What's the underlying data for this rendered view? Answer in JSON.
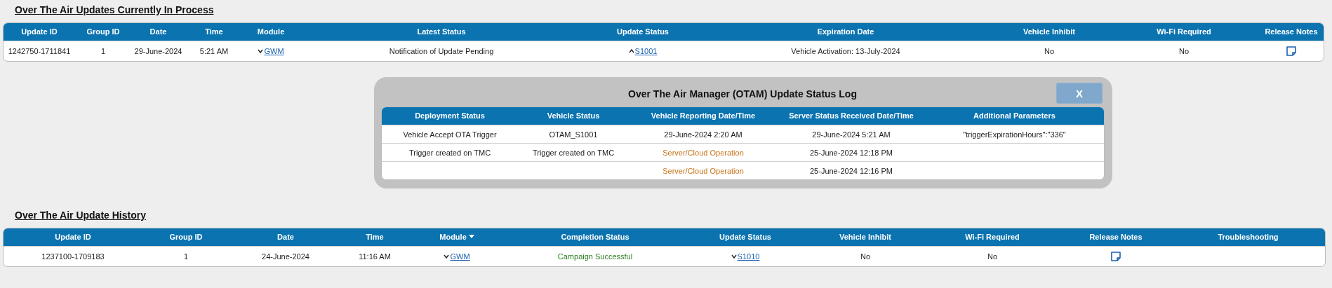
{
  "current": {
    "title": "Over The Air Updates Currently In Process",
    "columns": [
      {
        "label": "Update ID",
        "sorted": false
      },
      {
        "label": "Group ID",
        "sorted": false
      },
      {
        "label": "Date",
        "sorted": false
      },
      {
        "label": "Time",
        "sorted": false
      },
      {
        "label": "Module",
        "sorted": false
      },
      {
        "label": "Latest Status",
        "sorted": false
      },
      {
        "label": "Update Status",
        "sorted": false
      },
      {
        "label": "Expiration Date",
        "sorted": false
      },
      {
        "label": "Vehicle Inhibit",
        "sorted": false
      },
      {
        "label": "Wi-Fi Required",
        "sorted": false
      },
      {
        "label": "Release Notes",
        "sorted": false
      }
    ],
    "rows": [
      [
        {
          "kind": "text",
          "text": "1242750-1711841"
        },
        {
          "kind": "text",
          "text": "1"
        },
        {
          "kind": "text",
          "text": "29-June-2024"
        },
        {
          "kind": "text",
          "text": "5:21 AM"
        },
        {
          "kind": "link",
          "text": "GWM",
          "expanded": false
        },
        {
          "kind": "text",
          "text": "Notification of Update Pending"
        },
        {
          "kind": "link",
          "text": "S1001",
          "expanded": true
        },
        {
          "kind": "text",
          "text": "Vehicle Activation: 13-July-2024"
        },
        {
          "kind": "text",
          "text": "No"
        },
        {
          "kind": "text",
          "text": "No"
        },
        {
          "kind": "note"
        }
      ]
    ]
  },
  "status_log": {
    "title": "Over The Air Manager (OTAM) Update Status Log",
    "close_label": "X",
    "columns": [
      {
        "label": "Deployment Status",
        "sorted": false
      },
      {
        "label": "Vehicle Status",
        "sorted": false
      },
      {
        "label": "Vehicle Reporting Date/Time",
        "sorted": false
      },
      {
        "label": "Server Status Received Date/Time",
        "sorted": false
      },
      {
        "label": "Additional Parameters",
        "sorted": false
      }
    ],
    "rows": [
      [
        {
          "kind": "text",
          "text": "Vehicle Accept OTA Trigger"
        },
        {
          "kind": "text",
          "text": "OTAM_S1001"
        },
        {
          "kind": "text",
          "text": "29-June-2024 2:20 AM"
        },
        {
          "kind": "text",
          "text": "29-June-2024 5:21 AM"
        },
        {
          "kind": "text",
          "text": "\"triggerExpirationHours\":\"336\""
        }
      ],
      [
        {
          "kind": "text",
          "text": "Trigger created on TMC"
        },
        {
          "kind": "text",
          "text": "Trigger created on TMC"
        },
        {
          "kind": "warning",
          "text": "Server/Cloud Operation"
        },
        {
          "kind": "text",
          "text": "25-June-2024 12:18 PM"
        },
        {
          "kind": "empty"
        }
      ],
      [
        {
          "kind": "empty"
        },
        {
          "kind": "empty"
        },
        {
          "kind": "warning",
          "text": "Server/Cloud Operation"
        },
        {
          "kind": "text",
          "text": "25-June-2024 12:16 PM"
        },
        {
          "kind": "empty"
        }
      ]
    ]
  },
  "history": {
    "title": "Over The Air Update History",
    "columns": [
      {
        "label": "Update ID",
        "sorted": false
      },
      {
        "label": "Group ID",
        "sorted": false
      },
      {
        "label": "Date",
        "sorted": false
      },
      {
        "label": "Time",
        "sorted": false
      },
      {
        "label": "Module",
        "sorted": true
      },
      {
        "label": "Completion Status",
        "sorted": false
      },
      {
        "label": "Update Status",
        "sorted": false
      },
      {
        "label": "Vehicle Inhibit",
        "sorted": false
      },
      {
        "label": "Wi-Fi Required",
        "sorted": false
      },
      {
        "label": "Release Notes",
        "sorted": false
      },
      {
        "label": "Troubleshooting",
        "sorted": false
      }
    ],
    "rows": [
      [
        {
          "kind": "text",
          "text": "1237100-1709183"
        },
        {
          "kind": "text",
          "text": "1"
        },
        {
          "kind": "text",
          "text": "24-June-2024"
        },
        {
          "kind": "text",
          "text": "11:16 AM"
        },
        {
          "kind": "link",
          "text": "GWM",
          "expanded": false
        },
        {
          "kind": "success",
          "text": "Campaign Successful"
        },
        {
          "kind": "link",
          "text": "S1010",
          "expanded": false
        },
        {
          "kind": "text",
          "text": "No"
        },
        {
          "kind": "text",
          "text": "No"
        },
        {
          "kind": "note"
        },
        {
          "kind": "empty"
        }
      ]
    ]
  }
}
